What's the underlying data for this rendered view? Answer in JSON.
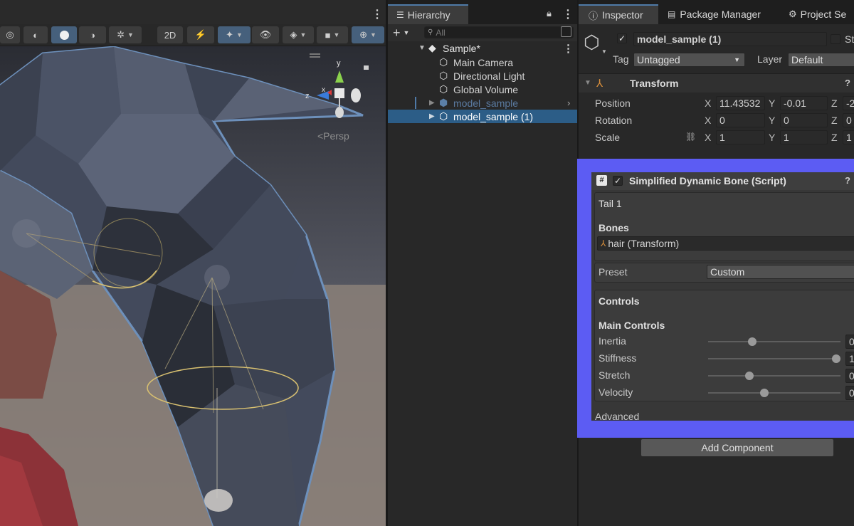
{
  "scene": {
    "persp_label": "<Persp",
    "gizmo_axes": {
      "y": "y",
      "z": "z",
      "x": "x"
    },
    "menu_icon": "kebab-icon"
  },
  "hierarchy": {
    "tab_label": "Hierarchy",
    "search_placeholder": "All",
    "rows": [
      {
        "label": "Sample*"
      },
      {
        "label": "Main Camera"
      },
      {
        "label": "Directional Light"
      },
      {
        "label": "Global Volume"
      },
      {
        "label": "model_sample"
      },
      {
        "label": "model_sample (1)"
      }
    ]
  },
  "inspector": {
    "tabs": [
      "Inspector",
      "Package Manager",
      "Project Se"
    ],
    "object_name": "model_sample (1)",
    "static_label": "St",
    "tag_label": "Tag",
    "tag_value": "Untagged",
    "layer_label": "Layer",
    "layer_value": "Default",
    "transform": {
      "title": "Transform",
      "position_label": "Position",
      "rotation_label": "Rotation",
      "scale_label": "Scale",
      "position": {
        "x": "11.43532",
        "y": "-0.01",
        "z": "-2"
      },
      "rotation": {
        "x": "0",
        "y": "0",
        "z": "0"
      },
      "scale": {
        "x": "1",
        "y": "1",
        "z": "1"
      },
      "axis_x": "X",
      "axis_y": "Y",
      "axis_z": "Z"
    },
    "script": {
      "title": "Simplified Dynamic Bone (Script)",
      "tail_label": "Tail 1",
      "bones_label": "Bones",
      "bones_value": "hair (Transform)",
      "preset_label": "Preset",
      "preset_value": "Custom",
      "controls_label": "Controls",
      "main_controls_label": "Main Controls",
      "sliders": [
        {
          "label": "Inertia",
          "value": 0.32,
          "readout": "0"
        },
        {
          "label": "Stiffness",
          "value": 1.0,
          "readout": "1"
        },
        {
          "label": "Stretch",
          "value": 0.3,
          "readout": "0"
        },
        {
          "label": "Velocity",
          "value": 0.42,
          "readout": "0"
        }
      ],
      "advanced_label": "Advanced"
    },
    "add_component_label": "Add Component"
  },
  "colors": {
    "highlight": "#5c5cf3",
    "selection": "#2c5d87",
    "accent_tab": "#4f7aa8"
  }
}
